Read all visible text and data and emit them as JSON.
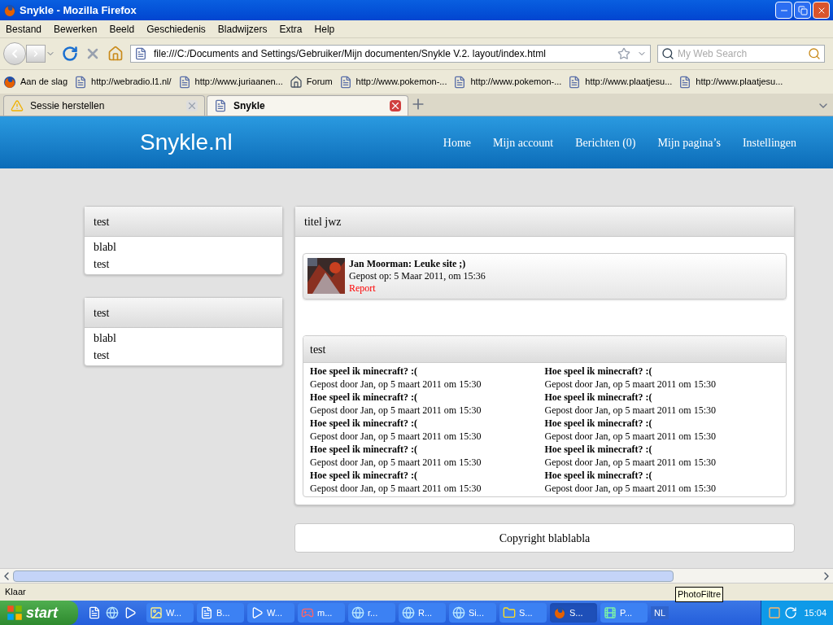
{
  "window": {
    "title": "Snykle - Mozilla Firefox"
  },
  "menu": [
    "Bestand",
    "Bewerken",
    "Beeld",
    "Geschiedenis",
    "Bladwijzers",
    "Extra",
    "Help"
  ],
  "address": {
    "value": "file:///C:/Documents and Settings/Gebruiker/Mijn documenten/Snykle V.2. layout/index.html"
  },
  "search": {
    "placeholder": "My Web Search"
  },
  "bookmarks": [
    {
      "label": "Aan de slag",
      "kind": "firefox"
    },
    {
      "label": "http://webradio.l1.nl/",
      "kind": "page"
    },
    {
      "label": "http://www.juriaanen...",
      "kind": "page"
    },
    {
      "label": "Forum",
      "kind": "forum"
    },
    {
      "label": "http://www.pokemon-...",
      "kind": "page"
    },
    {
      "label": "http://www.pokemon-...",
      "kind": "page"
    },
    {
      "label": "http://www.plaatjesu...",
      "kind": "page"
    },
    {
      "label": "http://www.plaatjesu...",
      "kind": "page"
    }
  ],
  "tabs": [
    {
      "label": "Sessie herstellen",
      "selected": false,
      "kind": "warning"
    },
    {
      "label": "Snykle",
      "selected": true,
      "kind": "page"
    }
  ],
  "site": {
    "logo": "Snykle.nl",
    "nav": [
      "Home",
      "Mijn account",
      "Berichten (0)",
      "Mijn pagina’s",
      "Instellingen"
    ],
    "sidebar": [
      {
        "title": "test",
        "lines": [
          "blabl",
          "test"
        ]
      },
      {
        "title": "test",
        "lines": [
          "blabl",
          "test"
        ]
      }
    ],
    "main": {
      "title": "titel jwz",
      "comment": {
        "author": "Jan Moorman: Leuke site ;)",
        "meta": "Gepost op: 5 Maar 2011, om 15:36",
        "report": "Report"
      },
      "posts_box": {
        "title": "test",
        "posts": [
          {
            "title": "Hoe speel ik minecraft? :(",
            "meta": "Gepost door Jan, op 5 maart 2011 om 15:30"
          },
          {
            "title": "Hoe speel ik minecraft? :(",
            "meta": "Gepost door Jan, op 5 maart 2011 om 15:30"
          },
          {
            "title": "Hoe speel ik minecraft? :(",
            "meta": "Gepost door Jan, op 5 maart 2011 om 15:30"
          },
          {
            "title": "Hoe speel ik minecraft? :(",
            "meta": "Gepost door Jan, op 5 maart 2011 om 15:30"
          },
          {
            "title": "Hoe speel ik minecraft? :(",
            "meta": "Gepost door Jan, op 5 maart 2011 om 15:30"
          },
          {
            "title": "Hoe speel ik minecraft? :(",
            "meta": "Gepost door Jan, op 5 maart 2011 om 15:30"
          },
          {
            "title": "Hoe speel ik minecraft? :(",
            "meta": "Gepost door Jan, op 5 maart 2011 om 15:30"
          },
          {
            "title": "Hoe speel ik minecraft? :(",
            "meta": "Gepost door Jan, op 5 maart 2011 om 15:30"
          },
          {
            "title": "Hoe speel ik minecraft? :(",
            "meta": "Gepost door Jan, op 5 maart 2011 om 15:30"
          },
          {
            "title": "Hoe speel ik minecraft? :(",
            "meta": "Gepost door Jan, op 5 maart 2011 om 15:30"
          }
        ]
      }
    },
    "footer": "Copyright blablabla"
  },
  "status_bar": {
    "text": "Klaar"
  },
  "taskbar": {
    "start": "start",
    "tasks": [
      {
        "label": "W...",
        "selected": false
      },
      {
        "label": "B...",
        "kind": "doc",
        "selected": false
      },
      {
        "label": "W...",
        "kind": "media",
        "selected": false
      },
      {
        "label": "m...",
        "kind": "game",
        "selected": false
      },
      {
        "label": "r...",
        "kind": "ie",
        "selected": false
      },
      {
        "label": "R...",
        "kind": "ie",
        "selected": false
      },
      {
        "label": "Si...",
        "kind": "ie",
        "selected": false
      },
      {
        "label": "S...",
        "kind": "folder",
        "selected": false
      },
      {
        "label": "S...",
        "kind": "firefox",
        "selected": true
      },
      {
        "label": "P...",
        "kind": "film",
        "selected": false
      }
    ],
    "language": "NL",
    "clock": "15:04",
    "tooltip": "PhotoFiltre"
  }
}
